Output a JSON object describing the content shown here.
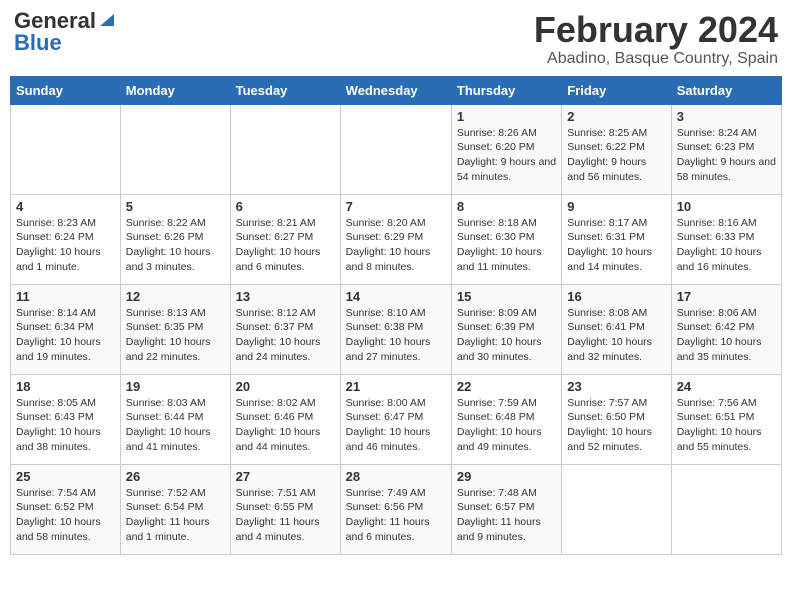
{
  "header": {
    "logo_general": "General",
    "logo_blue": "Blue",
    "month_title": "February 2024",
    "location": "Abadino, Basque Country, Spain"
  },
  "weekdays": [
    "Sunday",
    "Monday",
    "Tuesday",
    "Wednesday",
    "Thursday",
    "Friday",
    "Saturday"
  ],
  "weeks": [
    [
      {
        "day": "",
        "info": ""
      },
      {
        "day": "",
        "info": ""
      },
      {
        "day": "",
        "info": ""
      },
      {
        "day": "",
        "info": ""
      },
      {
        "day": "1",
        "info": "Sunrise: 8:26 AM\nSunset: 6:20 PM\nDaylight: 9 hours and 54 minutes."
      },
      {
        "day": "2",
        "info": "Sunrise: 8:25 AM\nSunset: 6:22 PM\nDaylight: 9 hours and 56 minutes."
      },
      {
        "day": "3",
        "info": "Sunrise: 8:24 AM\nSunset: 6:23 PM\nDaylight: 9 hours and 58 minutes."
      }
    ],
    [
      {
        "day": "4",
        "info": "Sunrise: 8:23 AM\nSunset: 6:24 PM\nDaylight: 10 hours and 1 minute."
      },
      {
        "day": "5",
        "info": "Sunrise: 8:22 AM\nSunset: 6:26 PM\nDaylight: 10 hours and 3 minutes."
      },
      {
        "day": "6",
        "info": "Sunrise: 8:21 AM\nSunset: 6:27 PM\nDaylight: 10 hours and 6 minutes."
      },
      {
        "day": "7",
        "info": "Sunrise: 8:20 AM\nSunset: 6:29 PM\nDaylight: 10 hours and 8 minutes."
      },
      {
        "day": "8",
        "info": "Sunrise: 8:18 AM\nSunset: 6:30 PM\nDaylight: 10 hours and 11 minutes."
      },
      {
        "day": "9",
        "info": "Sunrise: 8:17 AM\nSunset: 6:31 PM\nDaylight: 10 hours and 14 minutes."
      },
      {
        "day": "10",
        "info": "Sunrise: 8:16 AM\nSunset: 6:33 PM\nDaylight: 10 hours and 16 minutes."
      }
    ],
    [
      {
        "day": "11",
        "info": "Sunrise: 8:14 AM\nSunset: 6:34 PM\nDaylight: 10 hours and 19 minutes."
      },
      {
        "day": "12",
        "info": "Sunrise: 8:13 AM\nSunset: 6:35 PM\nDaylight: 10 hours and 22 minutes."
      },
      {
        "day": "13",
        "info": "Sunrise: 8:12 AM\nSunset: 6:37 PM\nDaylight: 10 hours and 24 minutes."
      },
      {
        "day": "14",
        "info": "Sunrise: 8:10 AM\nSunset: 6:38 PM\nDaylight: 10 hours and 27 minutes."
      },
      {
        "day": "15",
        "info": "Sunrise: 8:09 AM\nSunset: 6:39 PM\nDaylight: 10 hours and 30 minutes."
      },
      {
        "day": "16",
        "info": "Sunrise: 8:08 AM\nSunset: 6:41 PM\nDaylight: 10 hours and 32 minutes."
      },
      {
        "day": "17",
        "info": "Sunrise: 8:06 AM\nSunset: 6:42 PM\nDaylight: 10 hours and 35 minutes."
      }
    ],
    [
      {
        "day": "18",
        "info": "Sunrise: 8:05 AM\nSunset: 6:43 PM\nDaylight: 10 hours and 38 minutes."
      },
      {
        "day": "19",
        "info": "Sunrise: 8:03 AM\nSunset: 6:44 PM\nDaylight: 10 hours and 41 minutes."
      },
      {
        "day": "20",
        "info": "Sunrise: 8:02 AM\nSunset: 6:46 PM\nDaylight: 10 hours and 44 minutes."
      },
      {
        "day": "21",
        "info": "Sunrise: 8:00 AM\nSunset: 6:47 PM\nDaylight: 10 hours and 46 minutes."
      },
      {
        "day": "22",
        "info": "Sunrise: 7:59 AM\nSunset: 6:48 PM\nDaylight: 10 hours and 49 minutes."
      },
      {
        "day": "23",
        "info": "Sunrise: 7:57 AM\nSunset: 6:50 PM\nDaylight: 10 hours and 52 minutes."
      },
      {
        "day": "24",
        "info": "Sunrise: 7:56 AM\nSunset: 6:51 PM\nDaylight: 10 hours and 55 minutes."
      }
    ],
    [
      {
        "day": "25",
        "info": "Sunrise: 7:54 AM\nSunset: 6:52 PM\nDaylight: 10 hours and 58 minutes."
      },
      {
        "day": "26",
        "info": "Sunrise: 7:52 AM\nSunset: 6:54 PM\nDaylight: 11 hours and 1 minute."
      },
      {
        "day": "27",
        "info": "Sunrise: 7:51 AM\nSunset: 6:55 PM\nDaylight: 11 hours and 4 minutes."
      },
      {
        "day": "28",
        "info": "Sunrise: 7:49 AM\nSunset: 6:56 PM\nDaylight: 11 hours and 6 minutes."
      },
      {
        "day": "29",
        "info": "Sunrise: 7:48 AM\nSunset: 6:57 PM\nDaylight: 11 hours and 9 minutes."
      },
      {
        "day": "",
        "info": ""
      },
      {
        "day": "",
        "info": ""
      }
    ]
  ]
}
